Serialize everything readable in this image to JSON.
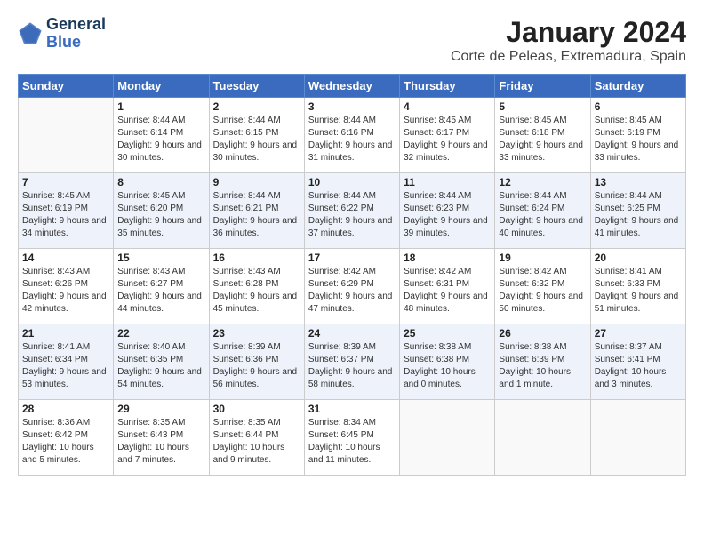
{
  "header": {
    "logo_line1": "General",
    "logo_line2": "Blue",
    "month_title": "January 2024",
    "location": "Corte de Peleas, Extremadura, Spain"
  },
  "weekdays": [
    "Sunday",
    "Monday",
    "Tuesday",
    "Wednesday",
    "Thursday",
    "Friday",
    "Saturday"
  ],
  "weeks": [
    [
      {
        "day": "",
        "sunrise": "",
        "sunset": "",
        "daylight": ""
      },
      {
        "day": "1",
        "sunrise": "Sunrise: 8:44 AM",
        "sunset": "Sunset: 6:14 PM",
        "daylight": "Daylight: 9 hours and 30 minutes."
      },
      {
        "day": "2",
        "sunrise": "Sunrise: 8:44 AM",
        "sunset": "Sunset: 6:15 PM",
        "daylight": "Daylight: 9 hours and 30 minutes."
      },
      {
        "day": "3",
        "sunrise": "Sunrise: 8:44 AM",
        "sunset": "Sunset: 6:16 PM",
        "daylight": "Daylight: 9 hours and 31 minutes."
      },
      {
        "day": "4",
        "sunrise": "Sunrise: 8:45 AM",
        "sunset": "Sunset: 6:17 PM",
        "daylight": "Daylight: 9 hours and 32 minutes."
      },
      {
        "day": "5",
        "sunrise": "Sunrise: 8:45 AM",
        "sunset": "Sunset: 6:18 PM",
        "daylight": "Daylight: 9 hours and 33 minutes."
      },
      {
        "day": "6",
        "sunrise": "Sunrise: 8:45 AM",
        "sunset": "Sunset: 6:19 PM",
        "daylight": "Daylight: 9 hours and 33 minutes."
      }
    ],
    [
      {
        "day": "7",
        "sunrise": "Sunrise: 8:45 AM",
        "sunset": "Sunset: 6:19 PM",
        "daylight": "Daylight: 9 hours and 34 minutes."
      },
      {
        "day": "8",
        "sunrise": "Sunrise: 8:45 AM",
        "sunset": "Sunset: 6:20 PM",
        "daylight": "Daylight: 9 hours and 35 minutes."
      },
      {
        "day": "9",
        "sunrise": "Sunrise: 8:44 AM",
        "sunset": "Sunset: 6:21 PM",
        "daylight": "Daylight: 9 hours and 36 minutes."
      },
      {
        "day": "10",
        "sunrise": "Sunrise: 8:44 AM",
        "sunset": "Sunset: 6:22 PM",
        "daylight": "Daylight: 9 hours and 37 minutes."
      },
      {
        "day": "11",
        "sunrise": "Sunrise: 8:44 AM",
        "sunset": "Sunset: 6:23 PM",
        "daylight": "Daylight: 9 hours and 39 minutes."
      },
      {
        "day": "12",
        "sunrise": "Sunrise: 8:44 AM",
        "sunset": "Sunset: 6:24 PM",
        "daylight": "Daylight: 9 hours and 40 minutes."
      },
      {
        "day": "13",
        "sunrise": "Sunrise: 8:44 AM",
        "sunset": "Sunset: 6:25 PM",
        "daylight": "Daylight: 9 hours and 41 minutes."
      }
    ],
    [
      {
        "day": "14",
        "sunrise": "Sunrise: 8:43 AM",
        "sunset": "Sunset: 6:26 PM",
        "daylight": "Daylight: 9 hours and 42 minutes."
      },
      {
        "day": "15",
        "sunrise": "Sunrise: 8:43 AM",
        "sunset": "Sunset: 6:27 PM",
        "daylight": "Daylight: 9 hours and 44 minutes."
      },
      {
        "day": "16",
        "sunrise": "Sunrise: 8:43 AM",
        "sunset": "Sunset: 6:28 PM",
        "daylight": "Daylight: 9 hours and 45 minutes."
      },
      {
        "day": "17",
        "sunrise": "Sunrise: 8:42 AM",
        "sunset": "Sunset: 6:29 PM",
        "daylight": "Daylight: 9 hours and 47 minutes."
      },
      {
        "day": "18",
        "sunrise": "Sunrise: 8:42 AM",
        "sunset": "Sunset: 6:31 PM",
        "daylight": "Daylight: 9 hours and 48 minutes."
      },
      {
        "day": "19",
        "sunrise": "Sunrise: 8:42 AM",
        "sunset": "Sunset: 6:32 PM",
        "daylight": "Daylight: 9 hours and 50 minutes."
      },
      {
        "day": "20",
        "sunrise": "Sunrise: 8:41 AM",
        "sunset": "Sunset: 6:33 PM",
        "daylight": "Daylight: 9 hours and 51 minutes."
      }
    ],
    [
      {
        "day": "21",
        "sunrise": "Sunrise: 8:41 AM",
        "sunset": "Sunset: 6:34 PM",
        "daylight": "Daylight: 9 hours and 53 minutes."
      },
      {
        "day": "22",
        "sunrise": "Sunrise: 8:40 AM",
        "sunset": "Sunset: 6:35 PM",
        "daylight": "Daylight: 9 hours and 54 minutes."
      },
      {
        "day": "23",
        "sunrise": "Sunrise: 8:39 AM",
        "sunset": "Sunset: 6:36 PM",
        "daylight": "Daylight: 9 hours and 56 minutes."
      },
      {
        "day": "24",
        "sunrise": "Sunrise: 8:39 AM",
        "sunset": "Sunset: 6:37 PM",
        "daylight": "Daylight: 9 hours and 58 minutes."
      },
      {
        "day": "25",
        "sunrise": "Sunrise: 8:38 AM",
        "sunset": "Sunset: 6:38 PM",
        "daylight": "Daylight: 10 hours and 0 minutes."
      },
      {
        "day": "26",
        "sunrise": "Sunrise: 8:38 AM",
        "sunset": "Sunset: 6:39 PM",
        "daylight": "Daylight: 10 hours and 1 minute."
      },
      {
        "day": "27",
        "sunrise": "Sunrise: 8:37 AM",
        "sunset": "Sunset: 6:41 PM",
        "daylight": "Daylight: 10 hours and 3 minutes."
      }
    ],
    [
      {
        "day": "28",
        "sunrise": "Sunrise: 8:36 AM",
        "sunset": "Sunset: 6:42 PM",
        "daylight": "Daylight: 10 hours and 5 minutes."
      },
      {
        "day": "29",
        "sunrise": "Sunrise: 8:35 AM",
        "sunset": "Sunset: 6:43 PM",
        "daylight": "Daylight: 10 hours and 7 minutes."
      },
      {
        "day": "30",
        "sunrise": "Sunrise: 8:35 AM",
        "sunset": "Sunset: 6:44 PM",
        "daylight": "Daylight: 10 hours and 9 minutes."
      },
      {
        "day": "31",
        "sunrise": "Sunrise: 8:34 AM",
        "sunset": "Sunset: 6:45 PM",
        "daylight": "Daylight: 10 hours and 11 minutes."
      },
      {
        "day": "",
        "sunrise": "",
        "sunset": "",
        "daylight": ""
      },
      {
        "day": "",
        "sunrise": "",
        "sunset": "",
        "daylight": ""
      },
      {
        "day": "",
        "sunrise": "",
        "sunset": "",
        "daylight": ""
      }
    ]
  ]
}
